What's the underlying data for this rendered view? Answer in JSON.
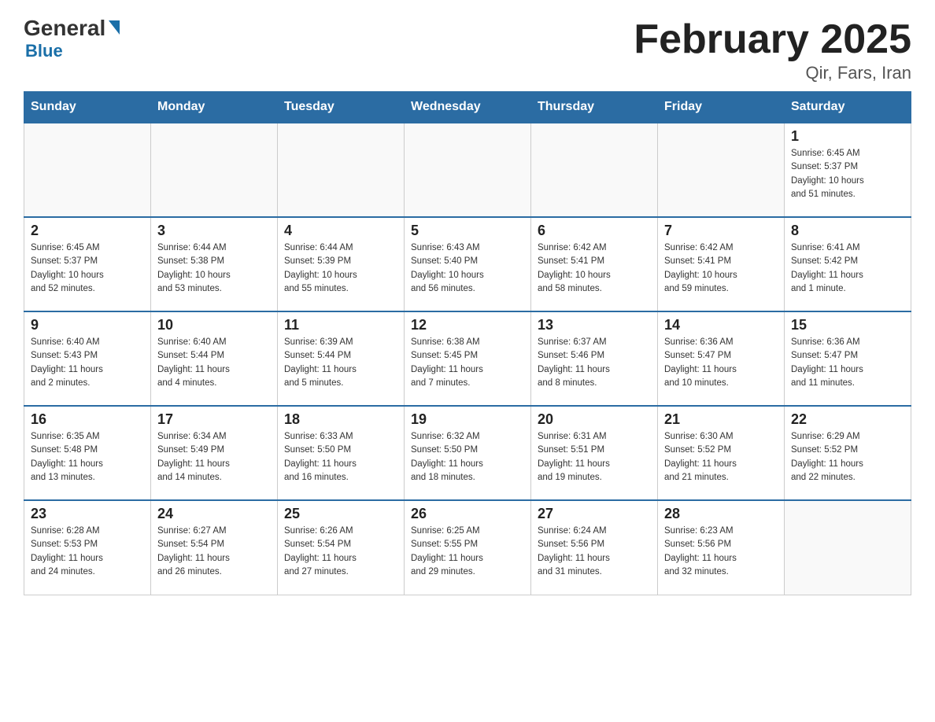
{
  "header": {
    "logo_general": "General",
    "logo_blue": "Blue",
    "month_title": "February 2025",
    "location": "Qir, Fars, Iran"
  },
  "days_of_week": [
    "Sunday",
    "Monday",
    "Tuesday",
    "Wednesday",
    "Thursday",
    "Friday",
    "Saturday"
  ],
  "weeks": [
    [
      {
        "day": "",
        "info": ""
      },
      {
        "day": "",
        "info": ""
      },
      {
        "day": "",
        "info": ""
      },
      {
        "day": "",
        "info": ""
      },
      {
        "day": "",
        "info": ""
      },
      {
        "day": "",
        "info": ""
      },
      {
        "day": "1",
        "info": "Sunrise: 6:45 AM\nSunset: 5:37 PM\nDaylight: 10 hours\nand 51 minutes."
      }
    ],
    [
      {
        "day": "2",
        "info": "Sunrise: 6:45 AM\nSunset: 5:37 PM\nDaylight: 10 hours\nand 52 minutes."
      },
      {
        "day": "3",
        "info": "Sunrise: 6:44 AM\nSunset: 5:38 PM\nDaylight: 10 hours\nand 53 minutes."
      },
      {
        "day": "4",
        "info": "Sunrise: 6:44 AM\nSunset: 5:39 PM\nDaylight: 10 hours\nand 55 minutes."
      },
      {
        "day": "5",
        "info": "Sunrise: 6:43 AM\nSunset: 5:40 PM\nDaylight: 10 hours\nand 56 minutes."
      },
      {
        "day": "6",
        "info": "Sunrise: 6:42 AM\nSunset: 5:41 PM\nDaylight: 10 hours\nand 58 minutes."
      },
      {
        "day": "7",
        "info": "Sunrise: 6:42 AM\nSunset: 5:41 PM\nDaylight: 10 hours\nand 59 minutes."
      },
      {
        "day": "8",
        "info": "Sunrise: 6:41 AM\nSunset: 5:42 PM\nDaylight: 11 hours\nand 1 minute."
      }
    ],
    [
      {
        "day": "9",
        "info": "Sunrise: 6:40 AM\nSunset: 5:43 PM\nDaylight: 11 hours\nand 2 minutes."
      },
      {
        "day": "10",
        "info": "Sunrise: 6:40 AM\nSunset: 5:44 PM\nDaylight: 11 hours\nand 4 minutes."
      },
      {
        "day": "11",
        "info": "Sunrise: 6:39 AM\nSunset: 5:44 PM\nDaylight: 11 hours\nand 5 minutes."
      },
      {
        "day": "12",
        "info": "Sunrise: 6:38 AM\nSunset: 5:45 PM\nDaylight: 11 hours\nand 7 minutes."
      },
      {
        "day": "13",
        "info": "Sunrise: 6:37 AM\nSunset: 5:46 PM\nDaylight: 11 hours\nand 8 minutes."
      },
      {
        "day": "14",
        "info": "Sunrise: 6:36 AM\nSunset: 5:47 PM\nDaylight: 11 hours\nand 10 minutes."
      },
      {
        "day": "15",
        "info": "Sunrise: 6:36 AM\nSunset: 5:47 PM\nDaylight: 11 hours\nand 11 minutes."
      }
    ],
    [
      {
        "day": "16",
        "info": "Sunrise: 6:35 AM\nSunset: 5:48 PM\nDaylight: 11 hours\nand 13 minutes."
      },
      {
        "day": "17",
        "info": "Sunrise: 6:34 AM\nSunset: 5:49 PM\nDaylight: 11 hours\nand 14 minutes."
      },
      {
        "day": "18",
        "info": "Sunrise: 6:33 AM\nSunset: 5:50 PM\nDaylight: 11 hours\nand 16 minutes."
      },
      {
        "day": "19",
        "info": "Sunrise: 6:32 AM\nSunset: 5:50 PM\nDaylight: 11 hours\nand 18 minutes."
      },
      {
        "day": "20",
        "info": "Sunrise: 6:31 AM\nSunset: 5:51 PM\nDaylight: 11 hours\nand 19 minutes."
      },
      {
        "day": "21",
        "info": "Sunrise: 6:30 AM\nSunset: 5:52 PM\nDaylight: 11 hours\nand 21 minutes."
      },
      {
        "day": "22",
        "info": "Sunrise: 6:29 AM\nSunset: 5:52 PM\nDaylight: 11 hours\nand 22 minutes."
      }
    ],
    [
      {
        "day": "23",
        "info": "Sunrise: 6:28 AM\nSunset: 5:53 PM\nDaylight: 11 hours\nand 24 minutes."
      },
      {
        "day": "24",
        "info": "Sunrise: 6:27 AM\nSunset: 5:54 PM\nDaylight: 11 hours\nand 26 minutes."
      },
      {
        "day": "25",
        "info": "Sunrise: 6:26 AM\nSunset: 5:54 PM\nDaylight: 11 hours\nand 27 minutes."
      },
      {
        "day": "26",
        "info": "Sunrise: 6:25 AM\nSunset: 5:55 PM\nDaylight: 11 hours\nand 29 minutes."
      },
      {
        "day": "27",
        "info": "Sunrise: 6:24 AM\nSunset: 5:56 PM\nDaylight: 11 hours\nand 31 minutes."
      },
      {
        "day": "28",
        "info": "Sunrise: 6:23 AM\nSunset: 5:56 PM\nDaylight: 11 hours\nand 32 minutes."
      },
      {
        "day": "",
        "info": ""
      }
    ]
  ]
}
